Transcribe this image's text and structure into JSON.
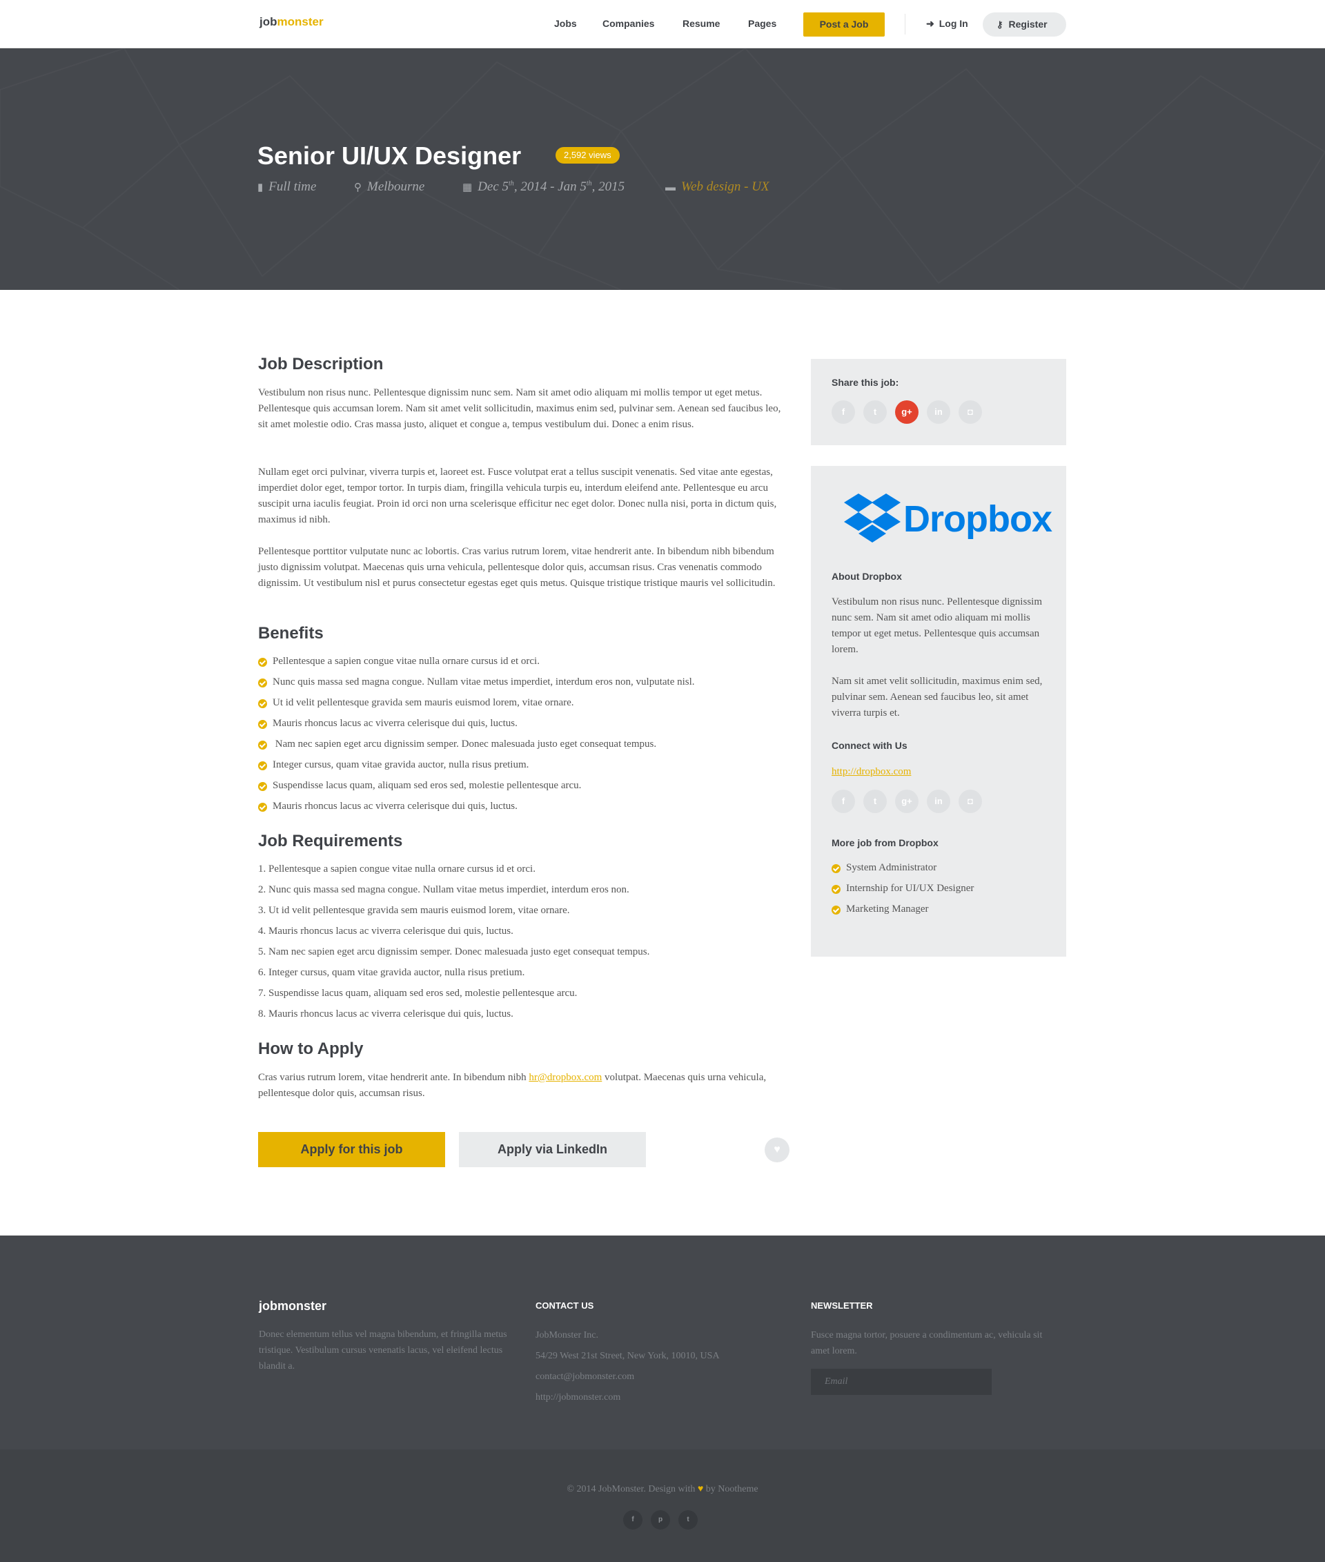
{
  "header": {
    "logo_part1": "job",
    "logo_part2": "monster",
    "nav": [
      "Jobs",
      "Companies",
      "Resume",
      "Pages"
    ],
    "post_job": "Post a Job",
    "login": "Log In",
    "register": "Register",
    "accent_color": "#e6b300"
  },
  "hero": {
    "title": "Senior UI/UX Designer",
    "views": "2,592 views",
    "job_type": "Full time",
    "location": "Melbourne",
    "date_from_day": "Dec 5",
    "date_from_sup": "th",
    "date_from_year": ", 2014 - Jan 5",
    "date_to_sup": "th",
    "date_to_year": ", 2015",
    "category": "Web design - UX"
  },
  "main": {
    "description_title": "Job Description",
    "description_paragraphs": [
      "Vestibulum non risus nunc. Pellentesque dignissim nunc sem. Nam sit amet odio aliquam mi mollis tempor ut eget metus. Pellentesque quis accumsan lorem. Nam sit amet velit sollicitudin, maximus enim sed, pulvinar sem. Aenean sed faucibus leo, sit amet molestie odio. Cras massa justo, aliquet et congue a, tempus vestibulum dui. Donec a enim risus.",
      "Nullam eget orci pulvinar, viverra turpis et, laoreet est. Fusce volutpat erat a tellus suscipit venenatis. Sed vitae ante egestas, imperdiet dolor eget, tempor tortor. In turpis diam, fringilla vehicula turpis eu, interdum eleifend ante. Pellentesque eu arcu suscipit urna iaculis feugiat. Proin id orci non urna scelerisque efficitur nec eget dolor. Donec nulla nisi, porta in dictum quis, maximus id nibh.",
      "Pellentesque porttitor vulputate nunc ac lobortis. Cras varius rutrum lorem, vitae hendrerit ante. In bibendum nibh bibendum justo dignissim volutpat. Maecenas quis urna vehicula, pellentesque dolor quis, accumsan risus. Cras venenatis commodo dignissim. Ut vestibulum nisl et purus consectetur egestas eget quis metus. Quisque tristique tristique mauris vel sollicitudin."
    ],
    "benefits_title": "Benefits",
    "benefits": [
      "Pellentesque a sapien congue vitae nulla ornare cursus id et orci.",
      "Nunc quis massa sed magna congue. Nullam vitae metus imperdiet, interdum eros non, vulputate nisl.",
      "Ut id velit pellentesque gravida sem mauris euismod lorem, vitae ornare.",
      "Mauris rhoncus lacus ac viverra celerisque dui quis, luctus.",
      " Nam nec sapien eget arcu dignissim semper. Donec malesuada justo eget consequat tempus.",
      "Integer cursus, quam vitae gravida auctor, nulla risus pretium.",
      "Suspendisse lacus quam, aliquam sed eros sed, molestie pellentesque arcu.",
      "Mauris rhoncus lacus ac viverra celerisque dui quis, luctus."
    ],
    "requirements_title": "Job Requirements",
    "requirements": [
      "1. Pellentesque a sapien congue vitae nulla ornare cursus id et orci.",
      "2. Nunc quis massa sed magna congue. Nullam vitae metus imperdiet, interdum eros non.",
      "3. Ut id velit pellentesque gravida sem mauris euismod lorem, vitae ornare.",
      "4. Mauris rhoncus lacus ac viverra celerisque dui quis, luctus.",
      "5. Nam nec sapien eget arcu dignissim semper. Donec malesuada justo eget consequat tempus.",
      "6. Integer cursus, quam vitae gravida auctor, nulla risus pretium.",
      "7. Suspendisse lacus quam, aliquam sed eros sed, molestie pellentesque arcu.",
      "8. Mauris rhoncus lacus ac viverra celerisque dui quis, luctus."
    ],
    "apply_title": "How to Apply",
    "apply_text_before": "Cras varius rutrum lorem, vitae hendrerit ante. In bibendum nibh ",
    "apply_email": "hr@dropbox.com",
    "apply_text_after": " volutpat. Maecenas quis urna vehicula, pellentesque dolor quis, accumsan risus.",
    "apply_button": "Apply for this job",
    "linkedin_button": "Apply via LinkedIn"
  },
  "sidebar": {
    "share_title": "Share this job:",
    "share_icons": [
      "facebook-icon",
      "twitter-icon",
      "google-plus-icon",
      "linkedin-icon",
      "instagram-icon"
    ],
    "share_glyphs": [
      "f",
      "t",
      "g+",
      "in",
      "◘"
    ],
    "company_name": "Dropbox",
    "about_title": "About Dropbox",
    "about_paragraphs": [
      "Vestibulum non risus nunc. Pellentesque dignissim nunc sem. Nam sit amet odio aliquam mi mollis tempor ut eget metus. Pellentesque quis accumsan lorem.",
      "Nam sit amet velit sollicitudin, maximus enim sed, pulvinar sem. Aenean sed faucibus leo, sit amet viverra turpis et."
    ],
    "connect_title": "Connect with Us",
    "website": "http://dropbox.com",
    "more_title": "More job from Dropbox",
    "more_jobs": [
      "System Administrator",
      "Internship for UI/UX Designer",
      "Marketing Manager"
    ],
    "brand_color": "#007ee5"
  },
  "footer": {
    "logo": "jobmonster",
    "about": "Donec elementum tellus vel magna bibendum, et fringilla metus tristique. Vestibulum cursus venenatis lacus, vel eleifend lectus blandit a.",
    "contact_title": "CONTACT US",
    "contact_lines": [
      "JobMonster Inc.",
      "54/29 West 21st Street, New York, 10010, USA",
      "contact@jobmonster.com",
      "http://jobmonster.com"
    ],
    "newsletter_title": "NEWSLETTER",
    "newsletter_text": "Fusce magna tortor, posuere a condimentum ac, vehicula sit amet lorem.",
    "email_placeholder": "Email",
    "copyright_before": "© 2014 JobMonster. Design with ",
    "copyright_after": " by Nootheme",
    "social_icons": [
      "facebook-icon",
      "pinterest-icon",
      "twitter-icon"
    ],
    "social_glyphs": [
      "f",
      "p",
      "t"
    ]
  }
}
